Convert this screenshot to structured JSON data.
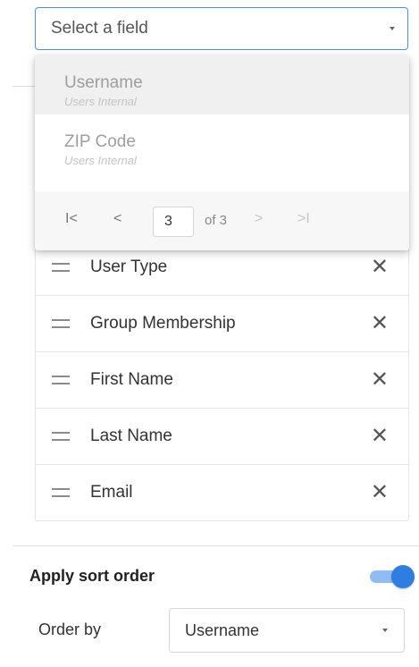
{
  "field_select": {
    "placeholder": "Select a field",
    "icon": "chevron-down-icon"
  },
  "dropdown": {
    "options": [
      {
        "name": "Username",
        "source": "Users Internal",
        "highlighted": true
      },
      {
        "name": "ZIP Code",
        "source": "Users Internal",
        "highlighted": false
      }
    ],
    "pagination": {
      "first": "I<",
      "prev": "<",
      "current_page": "3",
      "of_label": "of 3",
      "next": ">",
      "last": ">I"
    }
  },
  "fields": [
    {
      "label": "User Type",
      "remove": "✕"
    },
    {
      "label": "Group Membership",
      "remove": "✕"
    },
    {
      "label": "First Name",
      "remove": "✕"
    },
    {
      "label": "Last Name",
      "remove": "✕"
    },
    {
      "label": "Email",
      "remove": "✕"
    }
  ],
  "sort": {
    "label": "Apply sort order",
    "enabled": true,
    "order_by_label": "Order by",
    "order_by_value": "Username"
  },
  "colors": {
    "accent": "#2e7de1",
    "focus_border": "#4a8fe0",
    "highlight_row": "#f0f0f0"
  }
}
